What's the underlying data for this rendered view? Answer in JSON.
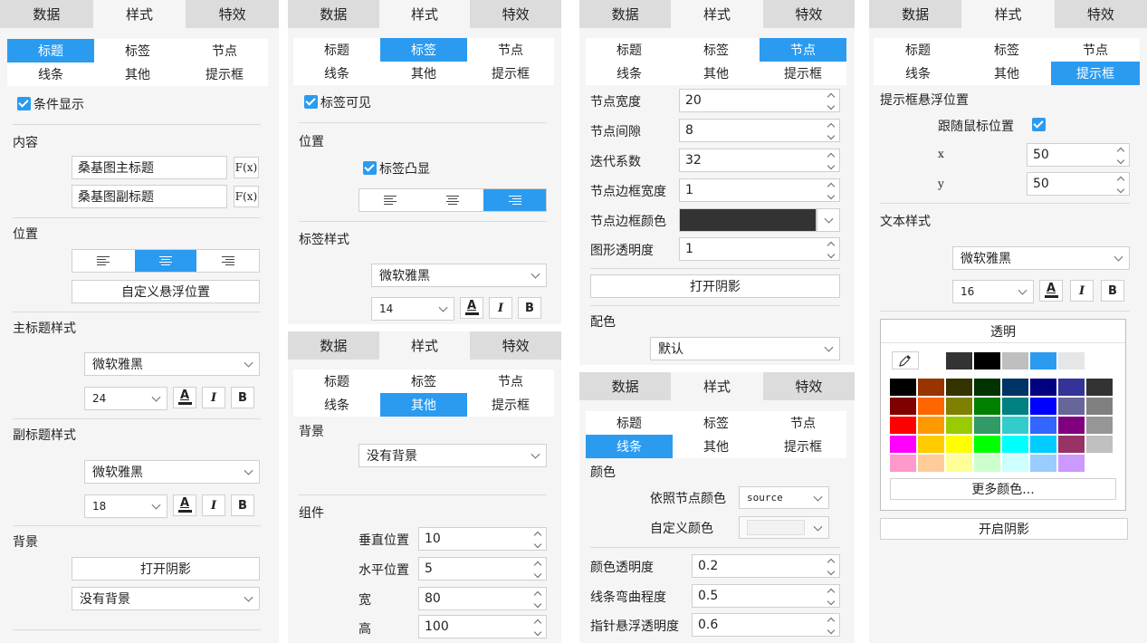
{
  "tabs": [
    "数据",
    "样式",
    "特效"
  ],
  "categories": [
    "标题",
    "标签",
    "节点",
    "线条",
    "其他",
    "提示框"
  ],
  "p1": {
    "cond_show": "条件显示",
    "content": "内容",
    "main_title": "桑基图主标题",
    "sub_title": "桑基图副标题",
    "fx": "F(x)",
    "position": "位置",
    "custom_float": "自定义悬浮位置",
    "main_title_style": "主标题样式",
    "font": "微软雅黑",
    "main_size": "24",
    "sub_title_style": "副标题样式",
    "sub_size": "18",
    "background": "背景",
    "open_shadow": "打开阴影",
    "no_bg": "没有背景",
    "bold": "B",
    "italic": "I",
    "color_a": "A"
  },
  "p2": {
    "label_visible": "标签可见",
    "position": "位置",
    "label_raised": "标签凸显",
    "label_style": "标签样式",
    "font": "微软雅黑",
    "size": "14",
    "bold": "B",
    "italic": "I",
    "color_a": "A"
  },
  "p3": {
    "background": "背景",
    "no_bg": "没有背景",
    "component": "组件",
    "vertical": "垂直位置",
    "vertical_val": "10",
    "horizontal": "水平位置",
    "horizontal_val": "5",
    "width": "宽",
    "width_val": "80",
    "height": "高",
    "height_val": "100"
  },
  "p4": {
    "node_width": "节点宽度",
    "node_width_val": "20",
    "node_gap": "节点间隙",
    "node_gap_val": "8",
    "iteration": "迭代系数",
    "iteration_val": "32",
    "border_width": "节点边框宽度",
    "border_width_val": "1",
    "border_color": "节点边框颜色",
    "border_color_hex": "#333333",
    "opacity": "图形透明度",
    "opacity_val": "1",
    "open_shadow": "打开阴影",
    "color_scheme": "配色",
    "default": "默认"
  },
  "p5": {
    "color": "颜色",
    "by_node_color": "依照节点颜色",
    "source": "source",
    "custom_color": "自定义颜色",
    "color_opacity": "颜色透明度",
    "color_opacity_val": "0.2",
    "curveness": "线条弯曲程度",
    "curveness_val": "0.5",
    "hover_opacity": "指针悬浮透明度",
    "hover_opacity_val": "0.6"
  },
  "p6": {
    "tooltip_pos": "提示框悬浮位置",
    "follow_mouse": "跟随鼠标位置",
    "x": "x",
    "x_val": "50",
    "y": "y",
    "y_val": "50",
    "text_style": "文本样式",
    "font": "微软雅黑",
    "size": "16",
    "bold": "B",
    "italic": "I",
    "color_a": "A",
    "transparent": "透明",
    "more_colors": "更多颜色...",
    "open_shadow": "开启阴影",
    "recent_colors": [
      "#333333",
      "#000000",
      "#bfbfbf",
      "#2b9bf0",
      "#e6e6e6"
    ],
    "palette_rows": [
      [
        "#000000",
        "#993300",
        "#333300",
        "#003300",
        "#003366",
        "#000080",
        "#333399",
        "#333333"
      ],
      [
        "#800000",
        "#ff6600",
        "#808000",
        "#008000",
        "#008080",
        "#0000ff",
        "#666699",
        "#808080"
      ],
      [
        "#ff0000",
        "#ff9900",
        "#99cc00",
        "#339966",
        "#33cccc",
        "#3366ff",
        "#800080",
        "#969696"
      ],
      [
        "#ff00ff",
        "#ffcc00",
        "#ffff00",
        "#00ff00",
        "#00ffff",
        "#00ccff",
        "#993366",
        "#c0c0c0"
      ],
      [
        "#ff99cc",
        "#ffcc99",
        "#ffff99",
        "#ccffcc",
        "#ccffff",
        "#99ccff",
        "#cc99ff",
        "#ffffff"
      ]
    ]
  }
}
